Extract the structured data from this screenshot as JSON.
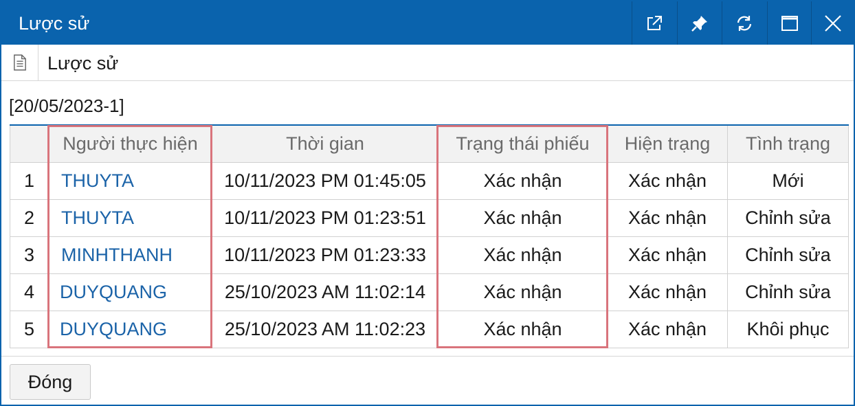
{
  "window": {
    "title": "Lược sử",
    "accent_color": "#0a63ad",
    "title_buttons": [
      {
        "icon": "external-link-icon"
      },
      {
        "icon": "pin-icon"
      },
      {
        "icon": "refresh-icon"
      },
      {
        "icon": "maximize-icon"
      },
      {
        "icon": "close-icon"
      }
    ]
  },
  "subheader": {
    "icon": "document-icon",
    "title": "Lược sử"
  },
  "record_code": "[20/05/2023-1]",
  "table": {
    "columns": [
      "",
      "Người thực hiện",
      "Thời gian",
      "Trạng thái phiếu",
      "Hiện trạng",
      "Tình trạng"
    ],
    "rows": [
      {
        "no": "1",
        "user": "THUYTA",
        "time": "10/11/2023 PM 01:45:05",
        "ticket_status": "Xác nhận",
        "current_state": "Xác nhận",
        "condition": "Mới"
      },
      {
        "no": "2",
        "user": "THUYTA",
        "time": "10/11/2023 PM 01:23:51",
        "ticket_status": "Xác nhận",
        "current_state": "Xác nhận",
        "condition": "Chỉnh sửa"
      },
      {
        "no": "3",
        "user": "MINHTHANH",
        "time": "10/11/2023 PM 01:23:33",
        "ticket_status": "Xác nhận",
        "current_state": "Xác nhận",
        "condition": "Chỉnh sửa"
      },
      {
        "no": "4",
        "user": "DUYQUANG",
        "time": "25/10/2023 AM 11:02:14",
        "ticket_status": "Xác nhận",
        "current_state": "Xác nhận",
        "condition": "Chỉnh sửa"
      },
      {
        "no": "5",
        "user": "DUYQUANG",
        "time": "25/10/2023 AM 11:02:23",
        "ticket_status": "Xác nhận",
        "current_state": "Xác nhận",
        "condition": "Khôi phục"
      }
    ],
    "highlight_color": "#d9747c",
    "link_color": "#1b63a8"
  },
  "footer": {
    "close_label": "Đóng"
  }
}
